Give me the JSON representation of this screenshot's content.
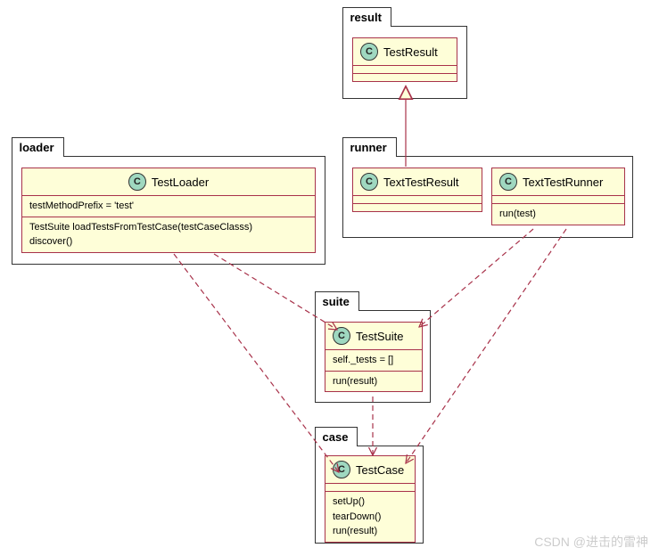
{
  "packages": {
    "result": {
      "label": "result"
    },
    "runner": {
      "label": "runner"
    },
    "loader": {
      "label": "loader"
    },
    "suite": {
      "label": "suite"
    },
    "case": {
      "label": "case"
    }
  },
  "classes": {
    "TestResult": {
      "stereotype": "C",
      "name": "TestResult",
      "attrs": [],
      "ops": []
    },
    "TextTestResult": {
      "stereotype": "C",
      "name": "TextTestResult",
      "attrs": [],
      "ops": []
    },
    "TextTestRunner": {
      "stereotype": "C",
      "name": "TextTestRunner",
      "attrs": [],
      "ops": [
        "run(test)"
      ]
    },
    "TestLoader": {
      "stereotype": "C",
      "name": "TestLoader",
      "attrs": [
        "testMethodPrefix = 'test'"
      ],
      "ops": [
        "TestSuite loadTestsFromTestCase(testCaseClasss)",
        "discover()"
      ]
    },
    "TestSuite": {
      "stereotype": "C",
      "name": "TestSuite",
      "attrs": [
        "self._tests = []"
      ],
      "ops": [
        "run(result)"
      ]
    },
    "TestCase": {
      "stereotype": "C",
      "name": "TestCase",
      "attrs": [],
      "ops": [
        "setUp()",
        "tearDown()",
        "run(result)"
      ]
    }
  },
  "relations": [
    {
      "from": "TextTestResult",
      "to": "TestResult",
      "type": "generalization"
    },
    {
      "from": "TestLoader",
      "to": "TestSuite",
      "type": "dependency"
    },
    {
      "from": "TestLoader",
      "to": "TestCase",
      "type": "dependency"
    },
    {
      "from": "TextTestRunner",
      "to": "TestSuite",
      "type": "dependency"
    },
    {
      "from": "TextTestRunner",
      "to": "TestCase",
      "type": "dependency"
    },
    {
      "from": "TestSuite",
      "to": "TestCase",
      "type": "dependency"
    }
  ],
  "watermark": "CSDN @进击的雷神"
}
